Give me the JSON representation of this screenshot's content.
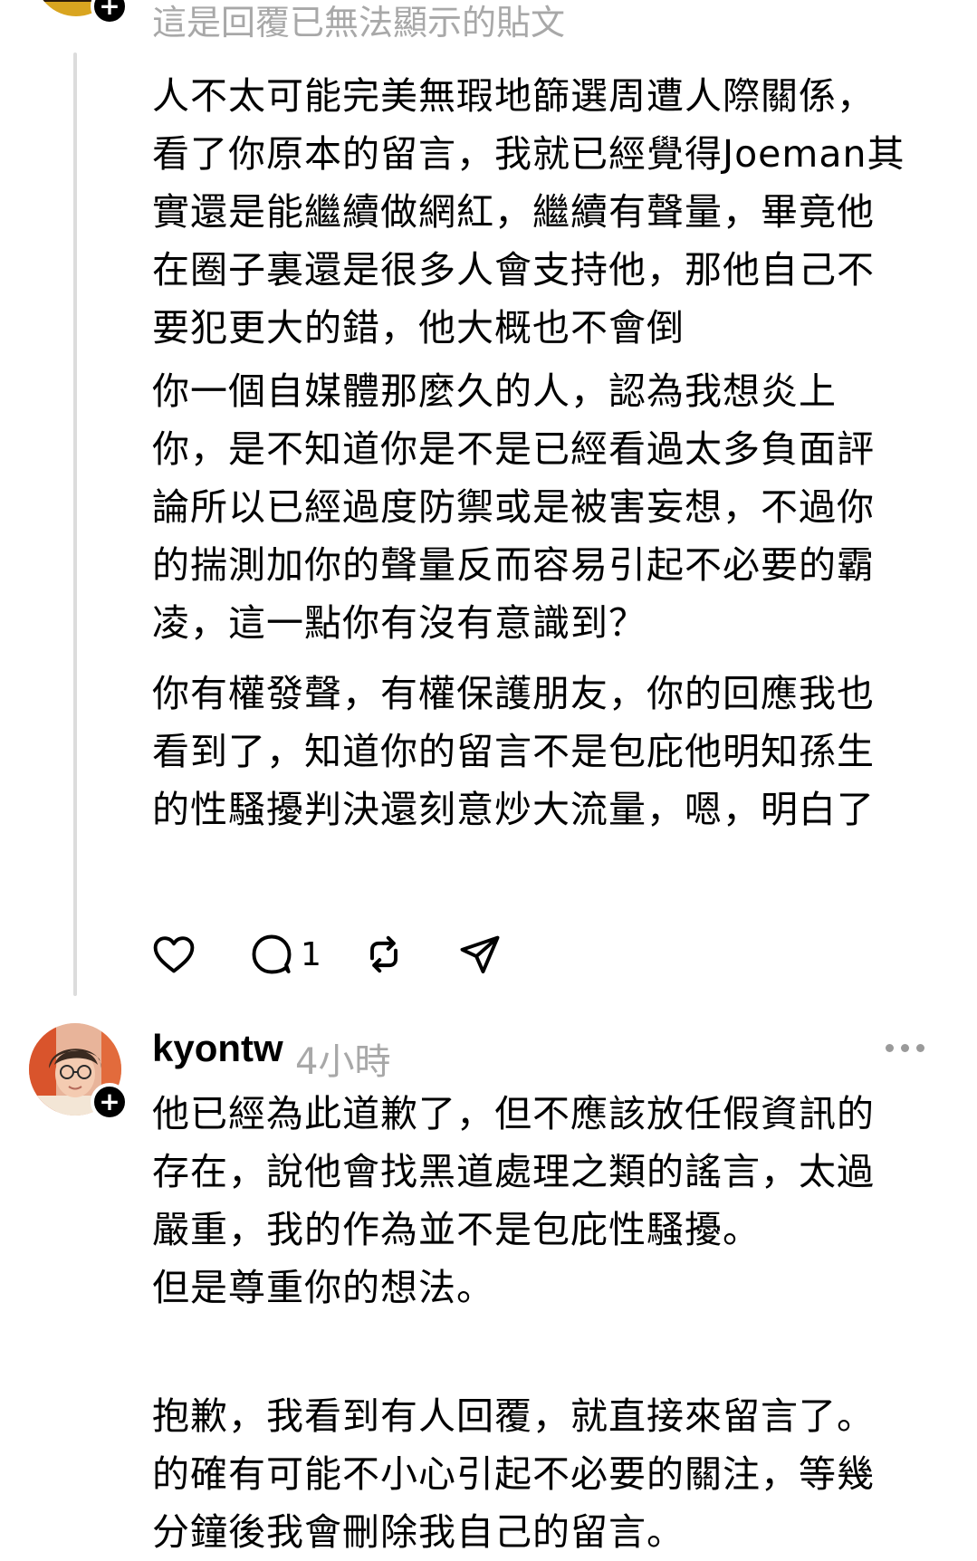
{
  "prior_comment": {
    "hidden_note": "這是回覆已無法顯示的貼文",
    "paragraphs": [
      "人不太可能完美無瑕地篩選周遭人際關係，\n看了你原本的留言，我就已經覺得Joeman其\n實還是能繼續做網紅，繼續有聲量，畢竟他\n在圈子裏還是很多人會支持他，那他自己不\n要犯更大的錯，他大概也不會倒",
      "你一個自媒體那麼久的人，認為我想炎上\n你，是不知道你是不是已經看過太多負面評\n論所以已經過度防禦或是被害妄想，不過你\n的揣測加你的聲量反而容易引起不必要的霸\n凌，這一點你有沒有意識到？",
      "你有權發聲，有權保護朋友，你的回應我也\n看到了，知道你的留言不是包庇他明知孫生\n的性騷擾判決還刻意炒大流量，嗯，明白了"
    ],
    "actions": {
      "like_icon": "heart-icon",
      "reply_icon": "comment-icon",
      "reply_count": "1",
      "repost_icon": "repost-icon",
      "share_icon": "send-icon"
    }
  },
  "reply": {
    "username": "kyontw",
    "timestamp": "4小時",
    "more_icon": "more-dots-icon",
    "paragraphs": [
      "他已經為此道歉了，但不應該放任假資訊的\n存在，說他會找黑道處理之類的謠言，太過\n嚴重，我的作為並不是包庇性騷擾。\n但是尊重你的想法。",
      "抱歉，我看到有人回覆，就直接來留言了。\n的確有可能不小心引起不必要的關注，等幾\n分鐘後我會刪除我自己的留言。"
    ]
  },
  "colors": {
    "text": "#000000",
    "muted": "#a8a8a8",
    "thread_line": "#dcdcdc",
    "background": "#ffffff"
  }
}
